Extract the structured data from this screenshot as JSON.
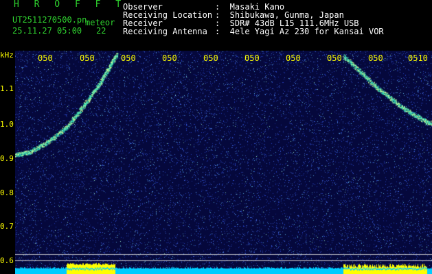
{
  "app": {
    "title": "H R O F F T",
    "file": "UT2511270500.pn",
    "meteor_label": "meteor",
    "date_time": "25.11.27 05:00",
    "count": "22"
  },
  "info": [
    {
      "label": "Observer",
      "value": ":  Masaki Kano"
    },
    {
      "label": "Receiving Location",
      "value": ":  Shibukawa, Gunma, Japan"
    },
    {
      "label": "Receiver",
      "value": ":  SDR# 43dB L15 111.6MHz USB"
    },
    {
      "label": "Receiving Antenna",
      "value": ":  4ele Yagi Az 230 for Kansai VOR"
    }
  ],
  "axis": {
    "unit": "kHz",
    "y_ticks": [
      "1.1",
      "1.0",
      "0.9",
      "0.8",
      "0.7",
      "0.6"
    ],
    "x_ticks": [
      "050",
      "050",
      "050",
      "050",
      "050",
      "050",
      "050",
      "050",
      "050",
      "0510"
    ]
  },
  "colors": {
    "background": "#05083c",
    "trace": "#2ee8c0",
    "axis_text": "#ffff00",
    "header_green": "#2fd42f",
    "baseline": "#00ccff",
    "burst": "#ffff00"
  }
}
